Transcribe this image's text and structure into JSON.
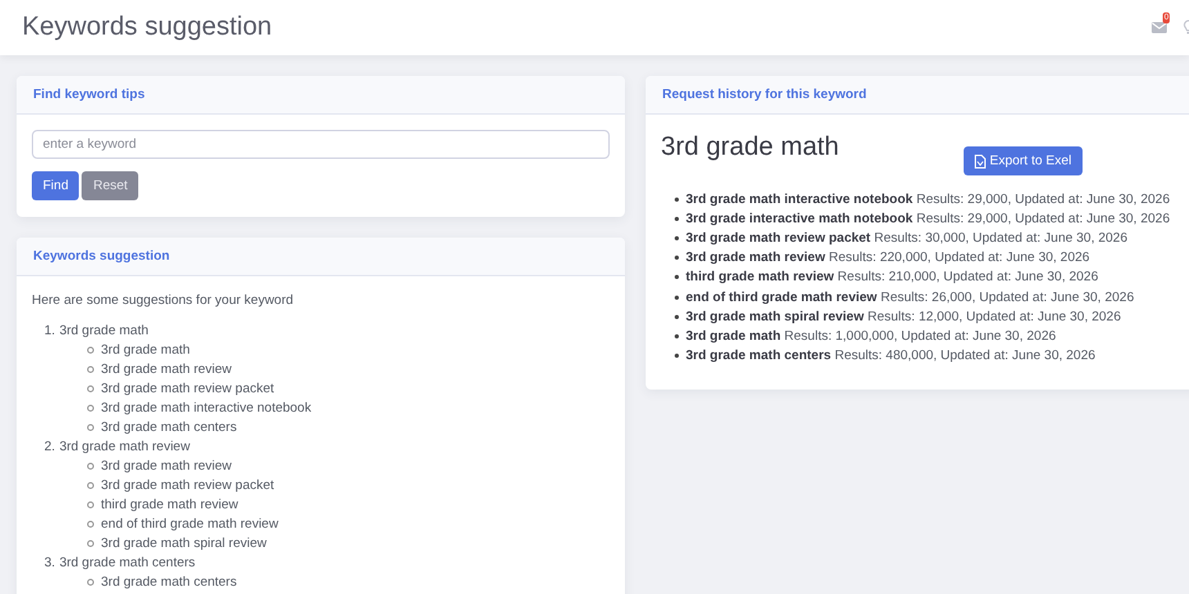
{
  "header": {
    "title": "Keywords suggestion",
    "notification_count": "0"
  },
  "find_card": {
    "title": "Find keyword tips",
    "search": {
      "placeholder": "enter a keyword"
    },
    "buttons": [
      {
        "label": "Find",
        "kind": "primary"
      },
      {
        "label": "Reset",
        "kind": "secondary"
      }
    ]
  },
  "suggestions_card": {
    "title": "Keywords suggestion",
    "intro": "Here are some suggestions for your keyword",
    "groups": [
      {
        "number": "1.",
        "label": "3rd grade math",
        "children": [
          "3rd grade math",
          "3rd grade math review",
          "3rd grade math review packet",
          "3rd grade math interactive notebook",
          "3rd grade math centers"
        ]
      },
      {
        "number": "2.",
        "label": "3rd grade math review",
        "children": [
          "3rd grade math review",
          "3rd grade math review packet",
          "third grade math review",
          "end of third grade math review",
          "3rd grade math spiral review"
        ]
      },
      {
        "number": "3.",
        "label": "3rd grade math centers",
        "children": [
          "3rd grade math centers"
        ]
      }
    ]
  },
  "history_card": {
    "title": "Request history for this keyword",
    "keyword": "3rd grade math",
    "export_button": "Export to Exel",
    "items": [
      "**3rd grade math interactive notebook** Results: 29,000, Updated at: June 30, 2026",
      "**3rd grade interactive math notebook** Results: 29,000, Updated at: June 30, 2026",
      "**3rd grade math review packet** Results: 30,000, Updated at: June 30, 2026",
      "**3rd grade math review** Results: 220,000, Updated at: June 30, 2026",
      "**third grade math review** Results: 210,000, Updated at: June 30, 2026",
      "**end of third grade math review** Results: 26,000, Updated at: June 30, 2026",
      "**3rd grade math spiral review** Results: 12,000, Updated at: June 30, 2026",
      "**3rd grade math** Results: 1,000,000, Updated at: June 30, 2026",
      "**3rd grade math centers** Results: 480,000, Updated at: June 30, 2026"
    ]
  }
}
